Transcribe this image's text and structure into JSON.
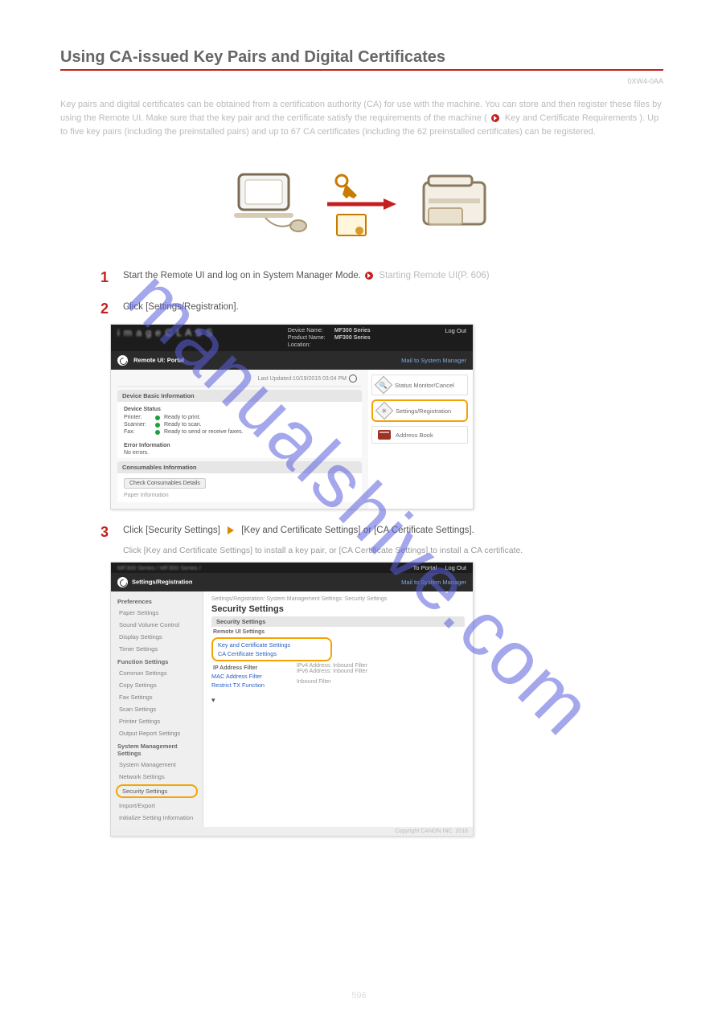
{
  "section_title": "Using CA-issued Key Pairs and Digital Certificates",
  "serial": "0XW4-0AA",
  "intro": "Key pairs and digital certificates can be obtained from a certification authority (CA) for use with the machine. You can store and then register these files by using the Remote UI. Make sure that the key pair and the certificate satisfy the requirements of the machine (",
  "intro_link_hint": "Key and Certificate Requirements",
  "intro_tail": "). Up to five key pairs (including the preinstalled pairs) and up to 67 CA certificates (including the 62 preinstalled certificates) can be registered.",
  "step1": {
    "num": "1",
    "text": "Start the Remote UI and log on in System Manager Mode.",
    "sub_link": "Starting Remote UI(P. 606)"
  },
  "step2": {
    "num": "2",
    "text": "Click [Settings/Registration]."
  },
  "step3": {
    "num": "3",
    "text": "Click [Security Settings]",
    "text_b": "[Key and Certificate Settings] or [CA Certificate Settings]."
  },
  "step3_sub": "Click [Key and Certificate Settings] to install a key pair, or [CA Certificate Settings] to install a CA certificate.",
  "shot1": {
    "brand": "i m a g e C L A S S",
    "dev_name_lbl": "Device Name:",
    "dev_name": "MF300 Series",
    "prod_lbl": "Product Name:",
    "prod": "MF300 Series",
    "loc_lbl": "Location:",
    "logout": "Log Out",
    "title": "Remote UI: Portal",
    "mailto": "Mail to System Manager",
    "updated": "Last Updated:10/19/2015 03:04 PM",
    "basic_head": "Device Basic Information",
    "status_head": "Device Status",
    "printer_lbl": "Printer:",
    "printer_txt": "Ready to print.",
    "scanner_lbl": "Scanner:",
    "scanner_txt": "Ready to scan.",
    "fax_lbl": "Fax:",
    "fax_txt": "Ready to send or receive faxes.",
    "err_head": "Error Information",
    "err_txt": "No errors.",
    "cons_head": "Consumables Information",
    "cons_btn": "Check Consumables Details",
    "paper": "Paper Information",
    "btn_status": "Status Monitor/Cancel",
    "btn_settings": "Settings/Registration",
    "btn_ab": "Address Book"
  },
  "shot2": {
    "series": "MF300 Series / MF300 Series /",
    "to_portal": "To Portal",
    "logout": "Log Out",
    "title": "Settings/Registration",
    "mail": "Mail to System Manager",
    "crumbs": "Settings/Registration: System Management Settings: Security Settings",
    "h": "Security Settings",
    "sub": "Security Settings",
    "remote": "Remote UI Settings",
    "key_link": "Key and Certificate Settings",
    "ca_link": "CA Certificate Settings",
    "ip_lbl": "IP Address Filter",
    "ip_a": "IPv4 Address: Inbound Filter",
    "ip_b": "IPv6 Address: Inbound Filter",
    "mac": "MAC Address Filter",
    "mac_a": "Inbound Filter",
    "restrict": "Restrict TX Function",
    "sb": {
      "pref": "Preferences",
      "pref_items": [
        "Paper Settings",
        "Sound Volume Control",
        "Display Settings",
        "Timer Settings"
      ],
      "func": "Function Settings",
      "func_items": [
        "Common Settings",
        "Copy Settings",
        "Fax Settings",
        "Scan Settings",
        "Printer Settings",
        "Output Report Settings"
      ],
      "sys": "System Management Settings",
      "sys_items": [
        "System Management",
        "Network Settings",
        "Security Settings",
        "Import/Export",
        "Initialize Setting Information"
      ]
    },
    "copyright": "Copyright CANON INC. 2016"
  },
  "page_no": "596",
  "watermark": "manualshive.com"
}
